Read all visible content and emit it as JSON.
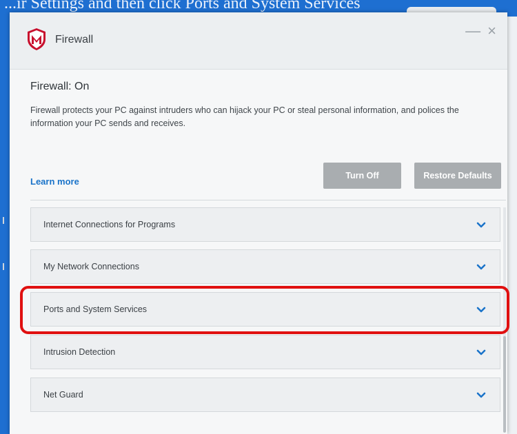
{
  "background": {
    "caption": "...ir Settings and then click Ports and System Services"
  },
  "window": {
    "title": "Firewall",
    "logo_icon": "mcafee-shield-icon",
    "controls": {
      "minimize": "—",
      "close": "×"
    }
  },
  "status": {
    "title": "Firewall: On",
    "description": "Firewall protects your PC against intruders who can hijack your PC or steal personal information, and polices the information your PC sends and receives."
  },
  "actions": {
    "learn_more": "Learn more",
    "turn_off": "Turn Off",
    "restore_defaults": "Restore Defaults"
  },
  "sections": [
    {
      "label": "Internet Connections for Programs"
    },
    {
      "label": "My Network Connections"
    },
    {
      "label": "Ports and System Services"
    },
    {
      "label": "Intrusion Detection"
    },
    {
      "label": "Net Guard"
    }
  ],
  "colors": {
    "accent_link": "#1a73c9",
    "highlight": "#e01010",
    "brand_red": "#c8102e",
    "button_gray": "#a9adb0"
  }
}
